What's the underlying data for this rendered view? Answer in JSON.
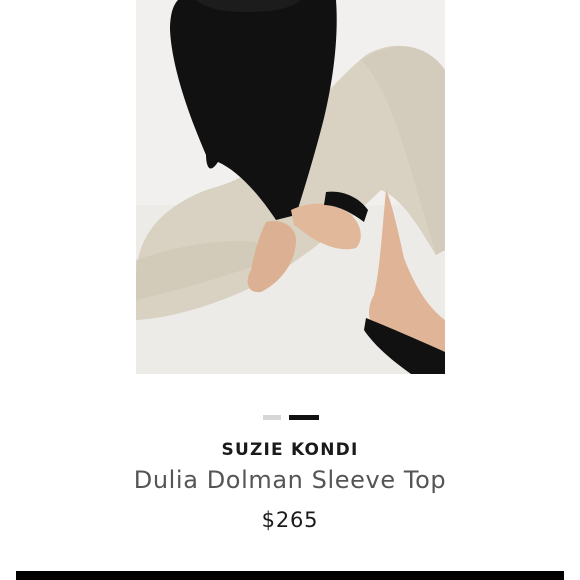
{
  "product": {
    "brand": "SUZIE KONDI",
    "title": "Dulia Dolman Sleeve Top",
    "price": "$265"
  },
  "carousel": {
    "slide_count": 2,
    "active_index": 1
  },
  "colors": {
    "top": "#111111",
    "pants": "#d9d2c3",
    "skin": "#e2b89a",
    "background": "#f1f0ee",
    "indicator_inactive": "#d6d6d6",
    "indicator_active": "#111111",
    "cta": "#000000"
  }
}
